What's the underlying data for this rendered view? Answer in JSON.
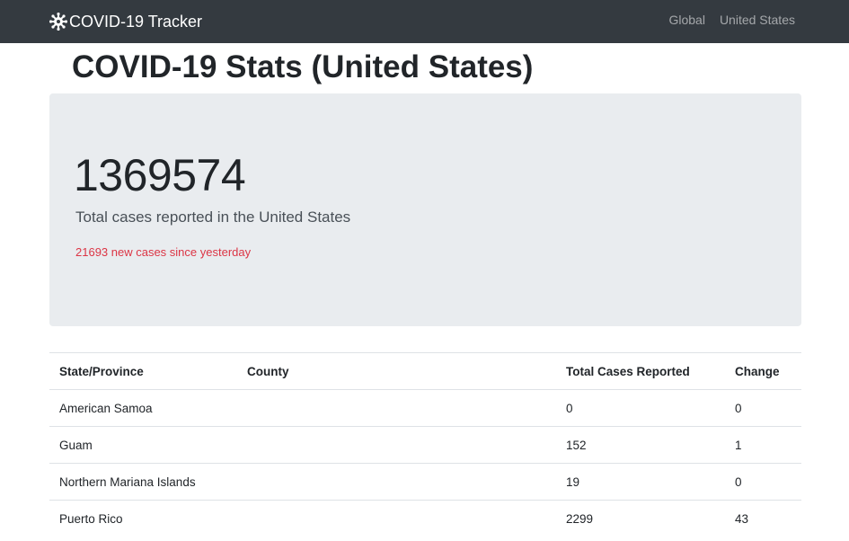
{
  "navbar": {
    "brand": "COVID-19 Tracker",
    "brand_icon": "virus-icon",
    "links": [
      "Global",
      "United States"
    ]
  },
  "page": {
    "title": "COVID-19 Stats (United States)"
  },
  "summary": {
    "total_cases": "1369574",
    "total_label": "Total cases reported in the United States",
    "new_cases_text": "21693 new cases since yesterday"
  },
  "table": {
    "headers": [
      "State/Province",
      "County",
      "Total Cases Reported",
      "Change"
    ],
    "rows": [
      {
        "state": "American Samoa",
        "county": "",
        "total": "0",
        "change": "0"
      },
      {
        "state": "Guam",
        "county": "",
        "total": "152",
        "change": "1"
      },
      {
        "state": "Northern Mariana Islands",
        "county": "",
        "total": "19",
        "change": "0"
      },
      {
        "state": "Puerto Rico",
        "county": "",
        "total": "2299",
        "change": "43"
      }
    ]
  },
  "colors": {
    "navbar_bg": "#343a40",
    "jumbotron_bg": "#e9ecef",
    "increase": "#dc3545",
    "no_change": "#28a745"
  }
}
